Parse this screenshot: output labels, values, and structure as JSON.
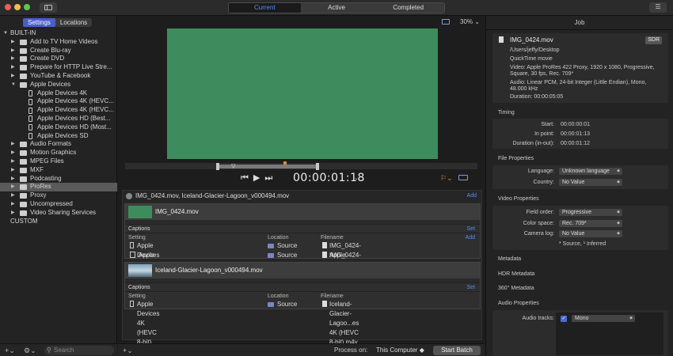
{
  "titlebar": {
    "segments": [
      "Current",
      "Active",
      "Completed"
    ],
    "active_segment": "Current"
  },
  "sidebar": {
    "tabs": [
      "Settings",
      "Locations"
    ],
    "selected_tab": "Settings",
    "items": [
      {
        "label": "BUILT-IN",
        "kind": "header"
      },
      {
        "label": "Add to TV Home Videos"
      },
      {
        "label": "Create Blu-ray"
      },
      {
        "label": "Create DVD"
      },
      {
        "label": "Prepare for HTTP Live Stre..."
      },
      {
        "label": "YouTube & Facebook"
      },
      {
        "label": "Apple Devices",
        "expanded": true
      },
      {
        "label": "Apple Devices 4K",
        "child": true
      },
      {
        "label": "Apple Devices 4K (HEVC...",
        "child": true
      },
      {
        "label": "Apple Devices 4K (HEVC...",
        "child": true
      },
      {
        "label": "Apple Devices HD (Best...",
        "child": true
      },
      {
        "label": "Apple Devices HD (Most...",
        "child": true
      },
      {
        "label": "Apple Devices SD",
        "child": true
      },
      {
        "label": "Audio Formats"
      },
      {
        "label": "Motion Graphics"
      },
      {
        "label": "MPEG Files"
      },
      {
        "label": "MXF"
      },
      {
        "label": "Podcasting"
      },
      {
        "label": "ProRes",
        "selected": true
      },
      {
        "label": "Proxy"
      },
      {
        "label": "Uncompressed"
      },
      {
        "label": "Video Sharing Services"
      },
      {
        "label": "CUSTOM",
        "kind": "header"
      }
    ],
    "search_placeholder": "Search"
  },
  "viewer": {
    "zoom": "30%",
    "timecode": "00:00:01:18"
  },
  "batch": {
    "title": "IMG_0424.mov, Iceland-Glacier-Lagoon_v000494.mov",
    "add_label": "Add",
    "jobs": [
      {
        "name": "IMG_0424.mov",
        "captions_label": "Captions",
        "set_label": "Set",
        "columns": [
          "Setting",
          "Location",
          "Filename"
        ],
        "add_label": "Add",
        "outputs": [
          {
            "setting": "Apple Devices 4K",
            "location": "Source",
            "filename": "IMG_0424-Apple Devices 4K.m4v"
          },
          {
            "setting": "Apple ProRes 422",
            "location": "Source",
            "filename": "IMG_0424-Apple ProRes 422.mov"
          }
        ]
      },
      {
        "name": "Iceland-Glacier-Lagoon_v000494.mov",
        "captions_label": "Captions",
        "set_label": "Set",
        "columns": [
          "Setting",
          "Location",
          "Filename"
        ],
        "outputs": [
          {
            "setting": "Apple Devices 4K (HEVC 8-bit)",
            "location": "Source",
            "filename": "Iceland-Glacier-Lagoo...es 4K (HEVC 8-bit).m4v"
          }
        ]
      }
    ]
  },
  "footer": {
    "process_label": "Process on:",
    "process_target": "This Computer",
    "start_button": "Start Batch"
  },
  "inspector": {
    "title": "Job",
    "file": {
      "name": "IMG_0424.mov",
      "badge": "SDR",
      "path": "/Users/jeffy/Desktop",
      "type": "QuickTime movie",
      "video": "Video: Apple ProRes 422 Proxy, 1920 x 1080, Progressive, Square, 30 fps, Rec. 709*",
      "audio": "Audio: Linear PCM, 24-bit Integer (Little Endian), Mono, 48.000 kHz",
      "duration": "Duration: 00:00:05:05"
    },
    "timing": {
      "header": "Timing",
      "start_label": "Start:",
      "start": "00:00:00:01",
      "in_label": "In point:",
      "in": "00:00:01:13",
      "dur_label": "Duration (in-out):",
      "dur": "00:00:01:12"
    },
    "file_props": {
      "header": "File Properties",
      "language_label": "Language:",
      "language": "Unknown language",
      "country_label": "Country:",
      "country": "No Value"
    },
    "video_props": {
      "header": "Video Properties",
      "field_label": "Field order:",
      "field": "Progressive",
      "color_label": "Color space:",
      "color": "Rec. 709*",
      "log_label": "Camera log:",
      "log": "No Value",
      "note": "* Source, ¹ Inferred"
    },
    "sections": [
      "Metadata",
      "HDR Metadata",
      "360° Metadata",
      "Audio Properties"
    ],
    "audio": {
      "tracks_label": "Audio tracks:",
      "track_value": "Mono"
    }
  }
}
